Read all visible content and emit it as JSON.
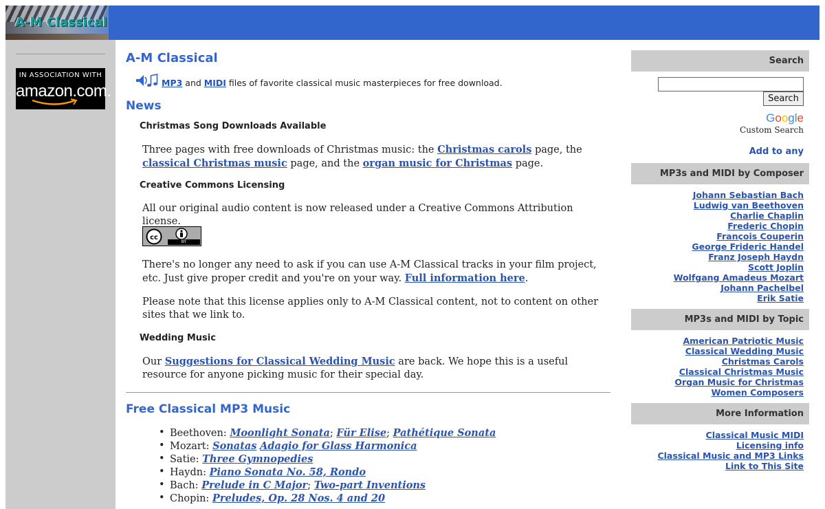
{
  "colors": {
    "banner": "#3366cc",
    "side_gray": "#cccccc",
    "link": "#2a54ae",
    "heading": "#3366cc"
  },
  "logo": {
    "text": "A-M Classical"
  },
  "amazon": {
    "association": "IN ASSOCIATION WITH",
    "name": "amazon.com."
  },
  "main": {
    "title": "A-M Classical",
    "intro": {
      "icon": "music-notes-icon",
      "mp3_link": "MP3",
      "and_text": " and ",
      "midi_link": "MIDI",
      "rest": " files of favorite classical music masterpieces for free download."
    },
    "news_heading": "News",
    "news": [
      {
        "title": "Christmas Song Downloads Available",
        "p1_a": "Three pages with free downloads of Christmas music: the ",
        "link1": "Christmas carols",
        "p1_b": " page, the ",
        "link2": "classical Christmas music",
        "p1_c": " page, and the ",
        "link3": "organ music for Christmas",
        "p1_d": " page."
      },
      {
        "title": "Creative Commons Licensing",
        "p1": "All our original audio content is now released under a Creative Commons Attribution license.",
        "badge_by": "BY",
        "p2_a": "There's no longer any need to ask if you can use A-M Classical tracks in your film project, etc. Just give proper credit and you're on your way. ",
        "p2_link": "Full information here",
        "p2_b": ".",
        "p3": "Please note that this license applies only to A-M Classical content, not to content on other sites that we link to."
      },
      {
        "title": "Wedding Music",
        "p1_a": "Our ",
        "link": "Suggestions for Classical Wedding Music",
        "p1_b": " are back. We hope this is a useful resource for anyone picking music for their special day."
      }
    ],
    "mp3_heading": "Free Classical MP3 Music",
    "mp3_list": [
      {
        "composer": "Beethoven: ",
        "links": [
          "Moonlight Sonata",
          "Für Elise",
          "Pathétique Sonata"
        ],
        "seps": [
          "; ",
          "; "
        ]
      },
      {
        "composer": "Mozart: ",
        "links": [
          "Sonatas",
          "Adagio for Glass Harmonica"
        ],
        "seps": [
          " "
        ]
      },
      {
        "composer": "Satie: ",
        "links": [
          "Three Gymnopedies"
        ],
        "seps": []
      },
      {
        "composer": "Haydn: ",
        "links": [
          "Piano Sonata No. 58, Rondo"
        ],
        "seps": []
      },
      {
        "composer": "Bach: ",
        "links": [
          "Prelude in C Major",
          "Two-part Inventions"
        ],
        "seps": [
          "; "
        ]
      },
      {
        "composer": "Chopin: ",
        "links": [
          "Preludes, Op. 28 Nos. 4 and 20"
        ],
        "seps": []
      }
    ]
  },
  "sidebar": {
    "search_heading": "Search",
    "search_value": "",
    "search_button": "Search",
    "google": "Google",
    "custom_search": "Custom Search",
    "add_to_any": "Add to any",
    "composer_heading": "MP3s and MIDI by Composer",
    "composers": [
      "Johann Sebastian Bach",
      "Ludwig van Beethoven",
      "Charlie Chaplin",
      "Frederic Chopin",
      "François Couperin",
      "George Frideric Handel",
      "Franz Joseph Haydn",
      "Scott Joplin",
      "Wolfgang Amadeus Mozart",
      "Johann Pachelbel",
      "Erik Satie"
    ],
    "topic_heading": "MP3s and MIDI by Topic",
    "topics": [
      "American Patriotic Music",
      "Classical Wedding Music",
      "Christmas Carols",
      "Classical Christmas Music",
      "Organ Music for Christmas",
      "Women Composers"
    ],
    "more_heading": "More Information",
    "more": [
      "Classical Music MIDI",
      "Licensing info",
      "Classical Music and MP3 Links",
      "Link to This Site"
    ]
  }
}
